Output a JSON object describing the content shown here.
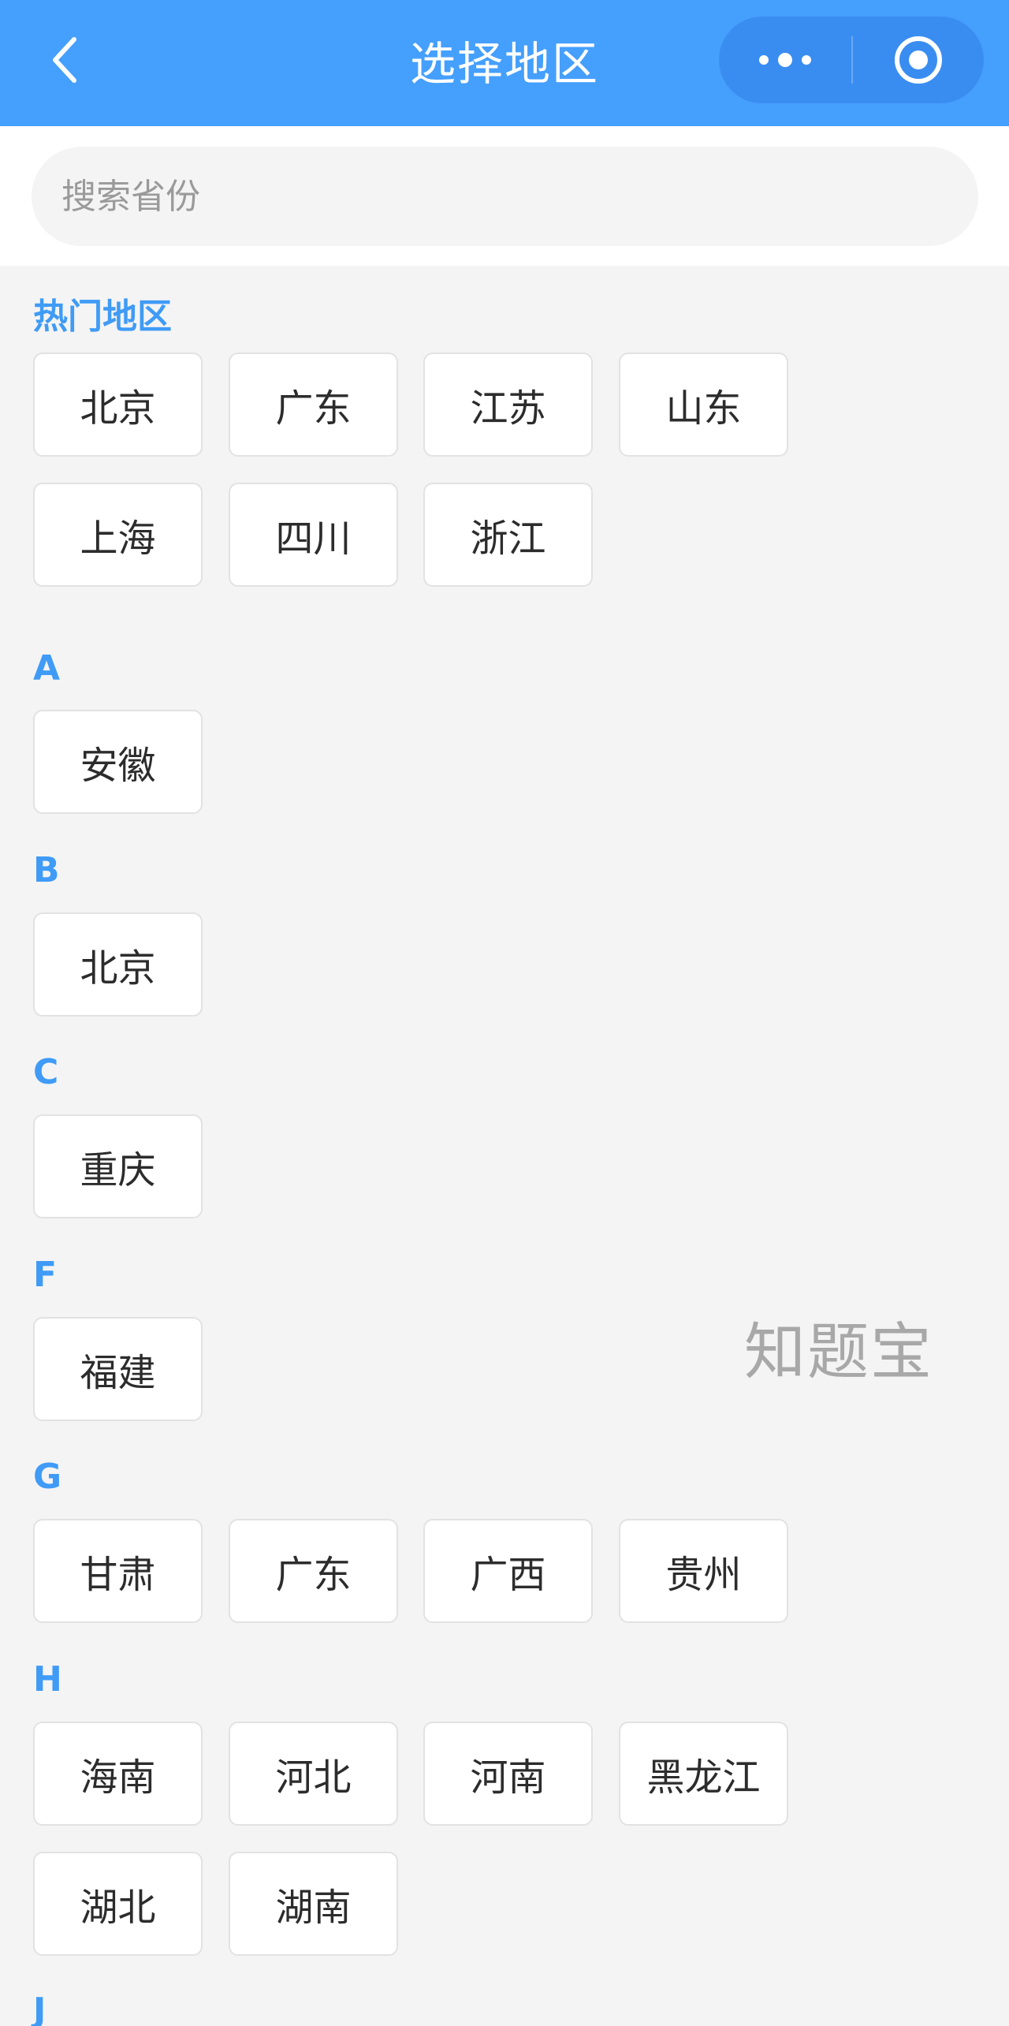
{
  "nav": {
    "title": "选择地区",
    "back_icon": "chevron-left-icon",
    "more_icon": "more-dots-icon",
    "close_icon": "target-circle-icon",
    "bg_color": "#459ffd"
  },
  "search": {
    "placeholder": "搜索省份",
    "value": ""
  },
  "hot": {
    "title": "热门地区",
    "items": [
      "北京",
      "广东",
      "江苏",
      "山东",
      "上海",
      "四川",
      "浙江"
    ]
  },
  "groups": [
    {
      "letter": "A",
      "items": [
        "安徽"
      ]
    },
    {
      "letter": "B",
      "items": [
        "北京"
      ]
    },
    {
      "letter": "C",
      "items": [
        "重庆"
      ]
    },
    {
      "letter": "F",
      "items": [
        "福建"
      ]
    },
    {
      "letter": "G",
      "items": [
        "甘肃",
        "广东",
        "广西",
        "贵州"
      ]
    },
    {
      "letter": "H",
      "items": [
        "海南",
        "河北",
        "河南",
        "黑龙江",
        "湖北",
        "湖南"
      ]
    },
    {
      "letter": "J",
      "items": []
    }
  ],
  "watermark": "知题宝",
  "colors": {
    "accent": "#3f9bf6",
    "page_bg": "#f4f4f4"
  }
}
